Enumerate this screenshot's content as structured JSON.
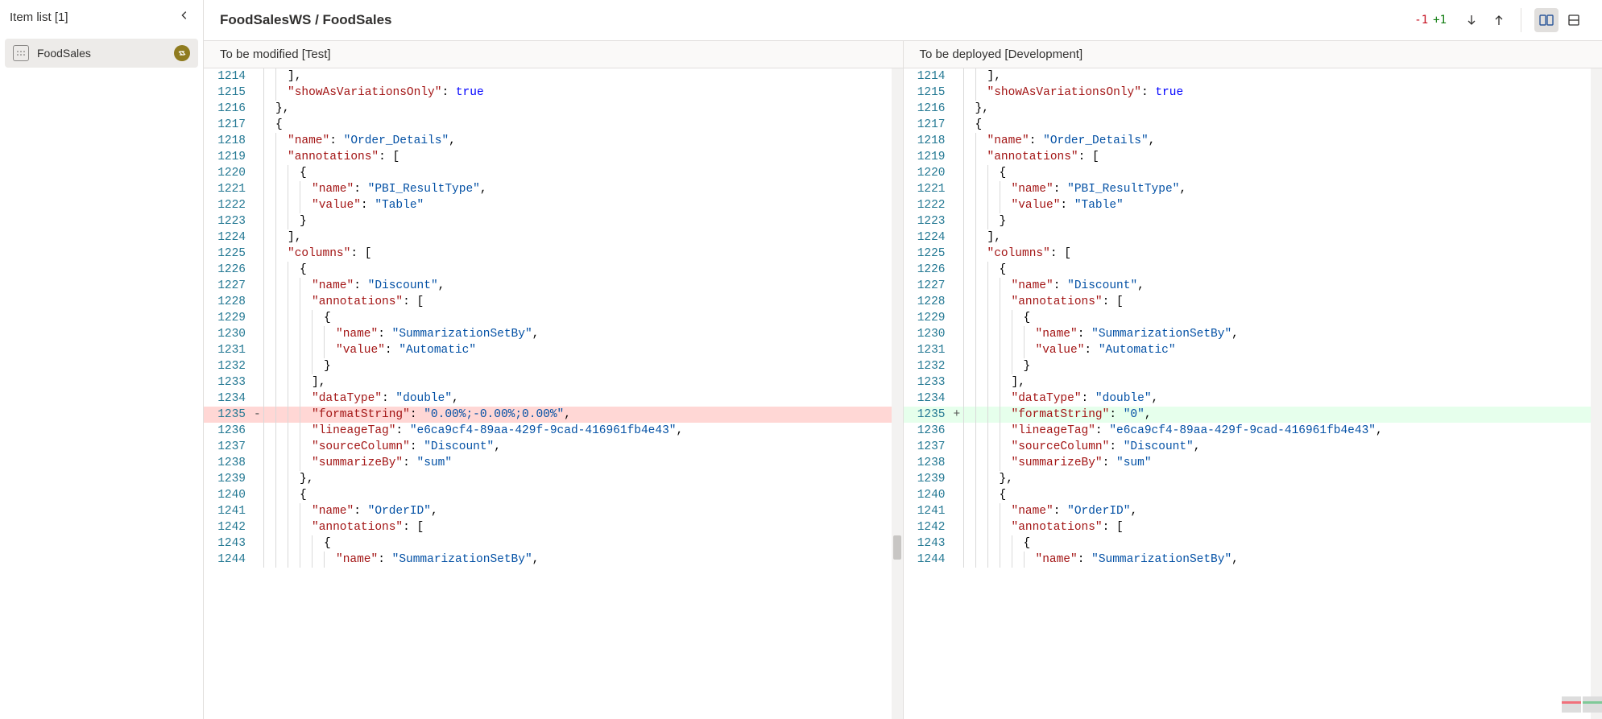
{
  "sidebar": {
    "title": "Item list [1]",
    "items": [
      {
        "label": "FoodSales"
      }
    ]
  },
  "header": {
    "breadcrumb": "FoodSalesWS / FoodSales",
    "removed": "-1",
    "added": "+1"
  },
  "panes": {
    "left_label": "To be modified [Test]",
    "right_label": "To be deployed [Development]"
  },
  "code": {
    "left": [
      {
        "n": 1214,
        "indent": 2,
        "tokens": [
          [
            "punc",
            "],"
          ]
        ]
      },
      {
        "n": 1215,
        "indent": 2,
        "tokens": [
          [
            "key",
            "\"showAsVariationsOnly\""
          ],
          [
            "punc",
            ": "
          ],
          [
            "lit",
            "true"
          ]
        ]
      },
      {
        "n": 1216,
        "indent": 1,
        "tokens": [
          [
            "punc",
            "},"
          ]
        ]
      },
      {
        "n": 1217,
        "indent": 1,
        "tokens": [
          [
            "punc",
            "{"
          ]
        ]
      },
      {
        "n": 1218,
        "indent": 2,
        "tokens": [
          [
            "key",
            "\"name\""
          ],
          [
            "punc",
            ": "
          ],
          [
            "str",
            "\"Order_Details\""
          ],
          [
            "punc",
            ","
          ]
        ]
      },
      {
        "n": 1219,
        "indent": 2,
        "tokens": [
          [
            "key",
            "\"annotations\""
          ],
          [
            "punc",
            ": ["
          ]
        ]
      },
      {
        "n": 1220,
        "indent": 3,
        "tokens": [
          [
            "punc",
            "{"
          ]
        ]
      },
      {
        "n": 1221,
        "indent": 4,
        "tokens": [
          [
            "key",
            "\"name\""
          ],
          [
            "punc",
            ": "
          ],
          [
            "str",
            "\"PBI_ResultType\""
          ],
          [
            "punc",
            ","
          ]
        ]
      },
      {
        "n": 1222,
        "indent": 4,
        "tokens": [
          [
            "key",
            "\"value\""
          ],
          [
            "punc",
            ": "
          ],
          [
            "str",
            "\"Table\""
          ]
        ]
      },
      {
        "n": 1223,
        "indent": 3,
        "tokens": [
          [
            "punc",
            "}"
          ]
        ]
      },
      {
        "n": 1224,
        "indent": 2,
        "tokens": [
          [
            "punc",
            "],"
          ]
        ]
      },
      {
        "n": 1225,
        "indent": 2,
        "tokens": [
          [
            "key",
            "\"columns\""
          ],
          [
            "punc",
            ": ["
          ]
        ]
      },
      {
        "n": 1226,
        "indent": 3,
        "tokens": [
          [
            "punc",
            "{"
          ]
        ]
      },
      {
        "n": 1227,
        "indent": 4,
        "tokens": [
          [
            "key",
            "\"name\""
          ],
          [
            "punc",
            ": "
          ],
          [
            "str",
            "\"Discount\""
          ],
          [
            "punc",
            ","
          ]
        ]
      },
      {
        "n": 1228,
        "indent": 4,
        "tokens": [
          [
            "key",
            "\"annotations\""
          ],
          [
            "punc",
            ": ["
          ]
        ]
      },
      {
        "n": 1229,
        "indent": 5,
        "tokens": [
          [
            "punc",
            "{"
          ]
        ]
      },
      {
        "n": 1230,
        "indent": 6,
        "tokens": [
          [
            "key",
            "\"name\""
          ],
          [
            "punc",
            ": "
          ],
          [
            "str",
            "\"SummarizationSetBy\""
          ],
          [
            "punc",
            ","
          ]
        ]
      },
      {
        "n": 1231,
        "indent": 6,
        "tokens": [
          [
            "key",
            "\"value\""
          ],
          [
            "punc",
            ": "
          ],
          [
            "str",
            "\"Automatic\""
          ]
        ]
      },
      {
        "n": 1232,
        "indent": 5,
        "tokens": [
          [
            "punc",
            "}"
          ]
        ]
      },
      {
        "n": 1233,
        "indent": 4,
        "tokens": [
          [
            "punc",
            "],"
          ]
        ]
      },
      {
        "n": 1234,
        "indent": 4,
        "tokens": [
          [
            "key",
            "\"dataType\""
          ],
          [
            "punc",
            ": "
          ],
          [
            "str",
            "\"double\""
          ],
          [
            "punc",
            ","
          ]
        ]
      },
      {
        "n": 1235,
        "indent": 4,
        "diff": "removed",
        "sign": "-",
        "tokens": [
          [
            "key",
            "\"formatString\""
          ],
          [
            "punc",
            ": "
          ],
          [
            "str",
            "\"0.00%;-0.00%;0.00%\""
          ],
          [
            "punc",
            ","
          ]
        ]
      },
      {
        "n": 1236,
        "indent": 4,
        "tokens": [
          [
            "key",
            "\"lineageTag\""
          ],
          [
            "punc",
            ": "
          ],
          [
            "str",
            "\"e6ca9cf4-89aa-429f-9cad-416961fb4e43\""
          ],
          [
            "punc",
            ","
          ]
        ]
      },
      {
        "n": 1237,
        "indent": 4,
        "tokens": [
          [
            "key",
            "\"sourceColumn\""
          ],
          [
            "punc",
            ": "
          ],
          [
            "str",
            "\"Discount\""
          ],
          [
            "punc",
            ","
          ]
        ]
      },
      {
        "n": 1238,
        "indent": 4,
        "tokens": [
          [
            "key",
            "\"summarizeBy\""
          ],
          [
            "punc",
            ": "
          ],
          [
            "str",
            "\"sum\""
          ]
        ]
      },
      {
        "n": 1239,
        "indent": 3,
        "tokens": [
          [
            "punc",
            "},"
          ]
        ]
      },
      {
        "n": 1240,
        "indent": 3,
        "tokens": [
          [
            "punc",
            "{"
          ]
        ]
      },
      {
        "n": 1241,
        "indent": 4,
        "tokens": [
          [
            "key",
            "\"name\""
          ],
          [
            "punc",
            ": "
          ],
          [
            "str",
            "\"OrderID\""
          ],
          [
            "punc",
            ","
          ]
        ]
      },
      {
        "n": 1242,
        "indent": 4,
        "tokens": [
          [
            "key",
            "\"annotations\""
          ],
          [
            "punc",
            ": ["
          ]
        ]
      },
      {
        "n": 1243,
        "indent": 5,
        "tokens": [
          [
            "punc",
            "{"
          ]
        ]
      },
      {
        "n": 1244,
        "indent": 6,
        "tokens": [
          [
            "key",
            "\"name\""
          ],
          [
            "punc",
            ": "
          ],
          [
            "str",
            "\"SummarizationSetBy\""
          ],
          [
            "punc",
            ","
          ]
        ]
      }
    ],
    "right": [
      {
        "n": 1214,
        "indent": 2,
        "tokens": [
          [
            "punc",
            "],"
          ]
        ]
      },
      {
        "n": 1215,
        "indent": 2,
        "tokens": [
          [
            "key",
            "\"showAsVariationsOnly\""
          ],
          [
            "punc",
            ": "
          ],
          [
            "lit",
            "true"
          ]
        ]
      },
      {
        "n": 1216,
        "indent": 1,
        "tokens": [
          [
            "punc",
            "},"
          ]
        ]
      },
      {
        "n": 1217,
        "indent": 1,
        "tokens": [
          [
            "punc",
            "{"
          ]
        ]
      },
      {
        "n": 1218,
        "indent": 2,
        "tokens": [
          [
            "key",
            "\"name\""
          ],
          [
            "punc",
            ": "
          ],
          [
            "str",
            "\"Order_Details\""
          ],
          [
            "punc",
            ","
          ]
        ]
      },
      {
        "n": 1219,
        "indent": 2,
        "tokens": [
          [
            "key",
            "\"annotations\""
          ],
          [
            "punc",
            ": ["
          ]
        ]
      },
      {
        "n": 1220,
        "indent": 3,
        "tokens": [
          [
            "punc",
            "{"
          ]
        ]
      },
      {
        "n": 1221,
        "indent": 4,
        "tokens": [
          [
            "key",
            "\"name\""
          ],
          [
            "punc",
            ": "
          ],
          [
            "str",
            "\"PBI_ResultType\""
          ],
          [
            "punc",
            ","
          ]
        ]
      },
      {
        "n": 1222,
        "indent": 4,
        "tokens": [
          [
            "key",
            "\"value\""
          ],
          [
            "punc",
            ": "
          ],
          [
            "str",
            "\"Table\""
          ]
        ]
      },
      {
        "n": 1223,
        "indent": 3,
        "tokens": [
          [
            "punc",
            "}"
          ]
        ]
      },
      {
        "n": 1224,
        "indent": 2,
        "tokens": [
          [
            "punc",
            "],"
          ]
        ]
      },
      {
        "n": 1225,
        "indent": 2,
        "tokens": [
          [
            "key",
            "\"columns\""
          ],
          [
            "punc",
            ": ["
          ]
        ]
      },
      {
        "n": 1226,
        "indent": 3,
        "tokens": [
          [
            "punc",
            "{"
          ]
        ]
      },
      {
        "n": 1227,
        "indent": 4,
        "tokens": [
          [
            "key",
            "\"name\""
          ],
          [
            "punc",
            ": "
          ],
          [
            "str",
            "\"Discount\""
          ],
          [
            "punc",
            ","
          ]
        ]
      },
      {
        "n": 1228,
        "indent": 4,
        "tokens": [
          [
            "key",
            "\"annotations\""
          ],
          [
            "punc",
            ": ["
          ]
        ]
      },
      {
        "n": 1229,
        "indent": 5,
        "tokens": [
          [
            "punc",
            "{"
          ]
        ]
      },
      {
        "n": 1230,
        "indent": 6,
        "tokens": [
          [
            "key",
            "\"name\""
          ],
          [
            "punc",
            ": "
          ],
          [
            "str",
            "\"SummarizationSetBy\""
          ],
          [
            "punc",
            ","
          ]
        ]
      },
      {
        "n": 1231,
        "indent": 6,
        "tokens": [
          [
            "key",
            "\"value\""
          ],
          [
            "punc",
            ": "
          ],
          [
            "str",
            "\"Automatic\""
          ]
        ]
      },
      {
        "n": 1232,
        "indent": 5,
        "tokens": [
          [
            "punc",
            "}"
          ]
        ]
      },
      {
        "n": 1233,
        "indent": 4,
        "tokens": [
          [
            "punc",
            "],"
          ]
        ]
      },
      {
        "n": 1234,
        "indent": 4,
        "tokens": [
          [
            "key",
            "\"dataType\""
          ],
          [
            "punc",
            ": "
          ],
          [
            "str",
            "\"double\""
          ],
          [
            "punc",
            ","
          ]
        ]
      },
      {
        "n": 1235,
        "indent": 4,
        "diff": "added",
        "sign": "+",
        "tokens": [
          [
            "key",
            "\"formatString\""
          ],
          [
            "punc",
            ": "
          ],
          [
            "str",
            "\"0\""
          ],
          [
            "punc",
            ","
          ]
        ]
      },
      {
        "n": 1236,
        "indent": 4,
        "tokens": [
          [
            "key",
            "\"lineageTag\""
          ],
          [
            "punc",
            ": "
          ],
          [
            "str",
            "\"e6ca9cf4-89aa-429f-9cad-416961fb4e43\""
          ],
          [
            "punc",
            ","
          ]
        ]
      },
      {
        "n": 1237,
        "indent": 4,
        "tokens": [
          [
            "key",
            "\"sourceColumn\""
          ],
          [
            "punc",
            ": "
          ],
          [
            "str",
            "\"Discount\""
          ],
          [
            "punc",
            ","
          ]
        ]
      },
      {
        "n": 1238,
        "indent": 4,
        "tokens": [
          [
            "key",
            "\"summarizeBy\""
          ],
          [
            "punc",
            ": "
          ],
          [
            "str",
            "\"sum\""
          ]
        ]
      },
      {
        "n": 1239,
        "indent": 3,
        "tokens": [
          [
            "punc",
            "},"
          ]
        ]
      },
      {
        "n": 1240,
        "indent": 3,
        "tokens": [
          [
            "punc",
            "{"
          ]
        ]
      },
      {
        "n": 1241,
        "indent": 4,
        "tokens": [
          [
            "key",
            "\"name\""
          ],
          [
            "punc",
            ": "
          ],
          [
            "str",
            "\"OrderID\""
          ],
          [
            "punc",
            ","
          ]
        ]
      },
      {
        "n": 1242,
        "indent": 4,
        "tokens": [
          [
            "key",
            "\"annotations\""
          ],
          [
            "punc",
            ": ["
          ]
        ]
      },
      {
        "n": 1243,
        "indent": 5,
        "tokens": [
          [
            "punc",
            "{"
          ]
        ]
      },
      {
        "n": 1244,
        "indent": 6,
        "tokens": [
          [
            "key",
            "\"name\""
          ],
          [
            "punc",
            ": "
          ],
          [
            "str",
            "\"SummarizationSetBy\""
          ],
          [
            "punc",
            ","
          ]
        ]
      }
    ]
  }
}
